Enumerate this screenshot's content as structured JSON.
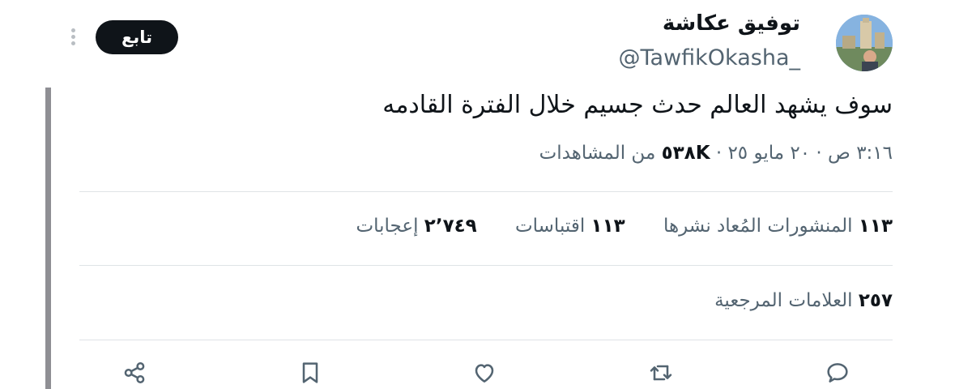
{
  "author": {
    "display_name": "توفيق عكاشة",
    "handle": "@TawfikOkasha_"
  },
  "header": {
    "follow_label": "تابع"
  },
  "tweet": {
    "text": "سوف يشهد العالم حدث جسيم خلال الفترة القادمه",
    "time_date": "٣:١٦ ص · ٢٠ مايو ٢٥ ·",
    "views_count": "٥٣٨K",
    "views_label": "من المشاهدات"
  },
  "stats": {
    "reposts_count": "١١٣",
    "reposts_label": "المنشورات المُعاد نشرها",
    "quotes_count": "١١٣",
    "quotes_label": "اقتباسات",
    "likes_count": "٢٬٧٤٩",
    "likes_label": "إعجابات",
    "bookmarks_count": "٢٥٧",
    "bookmarks_label": "العلامات المرجعية"
  },
  "actions": {
    "icons": [
      "reply-icon",
      "retweet-icon",
      "like-icon",
      "bookmark-icon",
      "share-icon"
    ]
  },
  "colors": {
    "text": "#0f1419",
    "secondary": "#536471",
    "divider": "#dfe3e6",
    "follow_bg": "#0f1419"
  }
}
